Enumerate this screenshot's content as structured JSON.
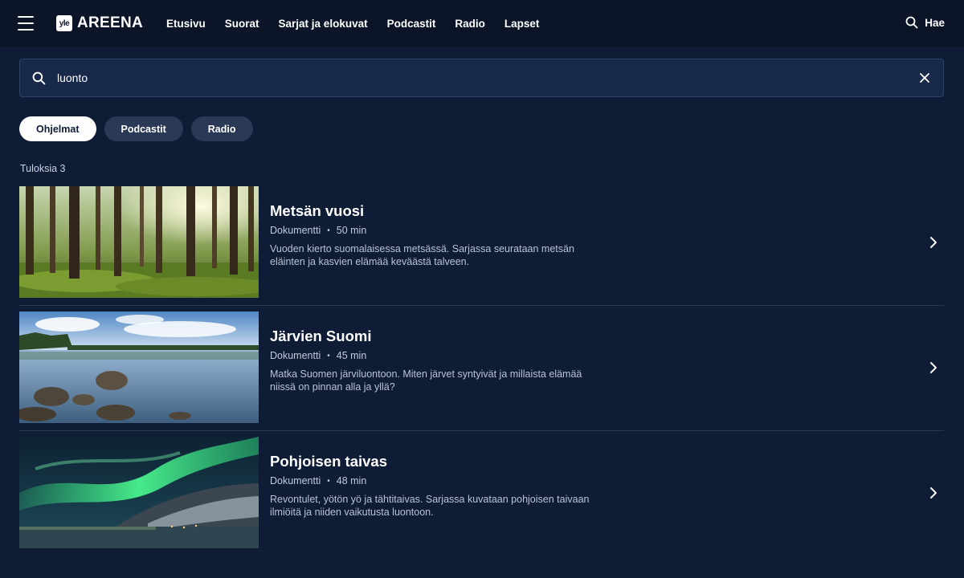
{
  "header": {
    "logo_badge": "yle",
    "logo_text": "AREENA",
    "nav": [
      "Etusivu",
      "Suorat",
      "Sarjat ja elokuvat",
      "Podcastit",
      "Radio",
      "Lapset"
    ],
    "search_label": "Hae"
  },
  "search": {
    "value": "luonto"
  },
  "filters": {
    "items": [
      "Ohjelmat",
      "Podcastit",
      "Radio"
    ],
    "active": "Ohjelmat"
  },
  "results": {
    "count_label": "Tuloksia 3",
    "items": [
      {
        "title": "Metsän vuosi",
        "genre": "Dokumentti",
        "duration": "50 min",
        "description": "Vuoden kierto suomalaisessa metsässä. Sarjassa seurataan metsän eläinten ja kasvien elämää keväästä talveen."
      },
      {
        "title": "Järvien Suomi",
        "genre": "Dokumentti",
        "duration": "45 min",
        "description": "Matka Suomen järviluontoon. Miten järvet syntyivät ja millaista elämää niissä on pinnan alla ja yllä?"
      },
      {
        "title": "Pohjoisen taivas",
        "genre": "Dokumentti",
        "duration": "48 min",
        "description": "Revontulet, yötön yö ja tähtitaivas. Sarjassa kuvataan pohjoisen taivaan ilmiöitä ja niiden vaikutusta luontoon."
      }
    ]
  },
  "colors": {
    "background": "#0f1c36",
    "header": "#0b1527",
    "accent_chip": "#ffffff",
    "chip": "#2a3a56"
  },
  "icons": {
    "menu": "hamburger-icon",
    "search": "search-icon",
    "clear": "close-icon",
    "chevron": "chevron-right-icon"
  }
}
